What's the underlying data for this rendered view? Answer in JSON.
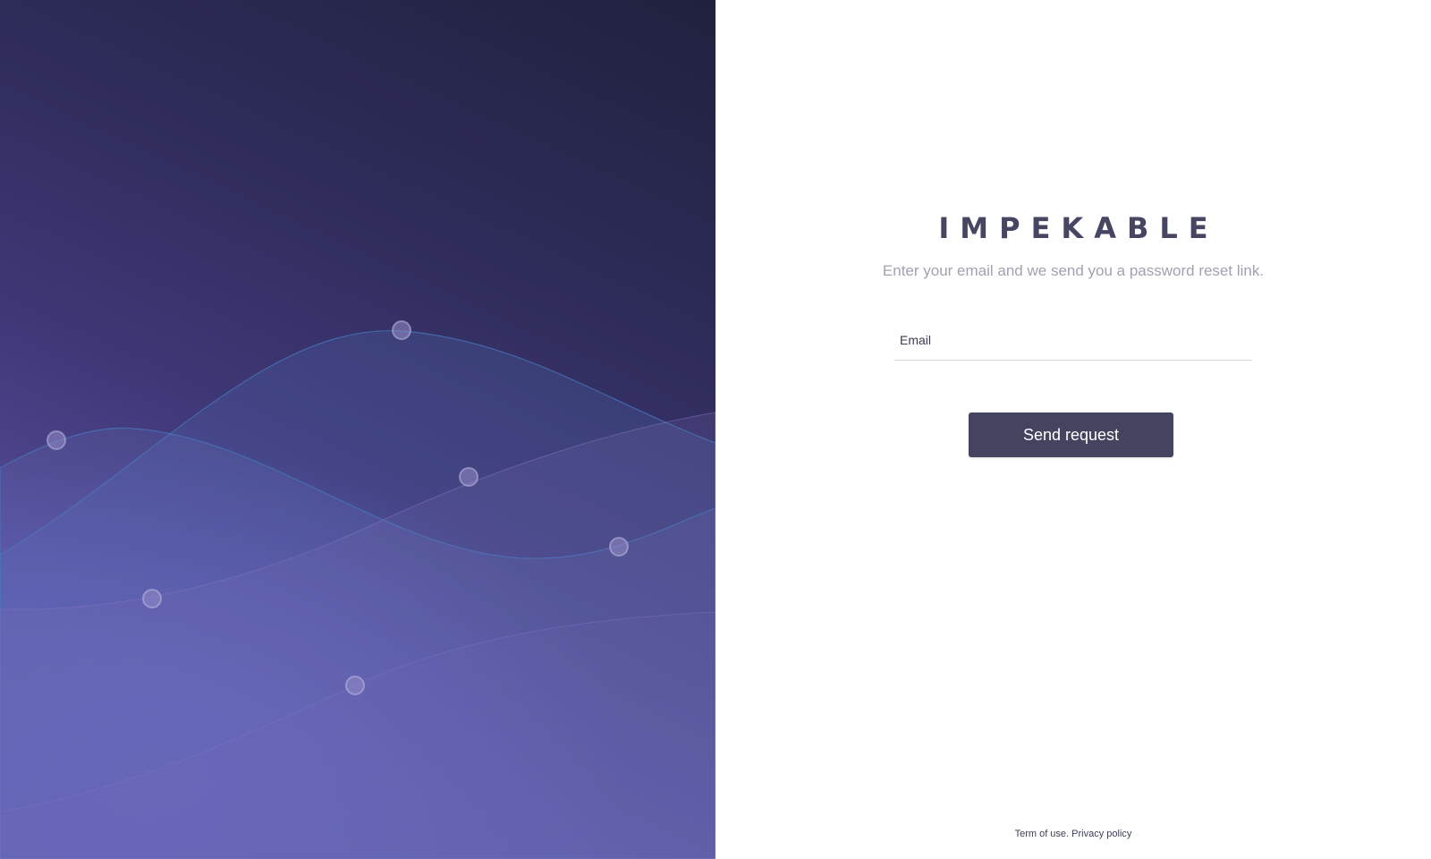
{
  "app": {
    "brand": "IMPEKABLE"
  },
  "reset": {
    "subtitle": "Enter your email and we send you a password reset link.",
    "email_placeholder": "Email",
    "email_value": "",
    "submit_label": "Send request"
  },
  "footer": {
    "terms_label": "Term of use.",
    "privacy_label": "Privacy policy"
  },
  "colors": {
    "brand_text": "#464663",
    "button_bg": "#454460",
    "hero_dark": "#20213e",
    "hero_light": "#6058ae"
  }
}
